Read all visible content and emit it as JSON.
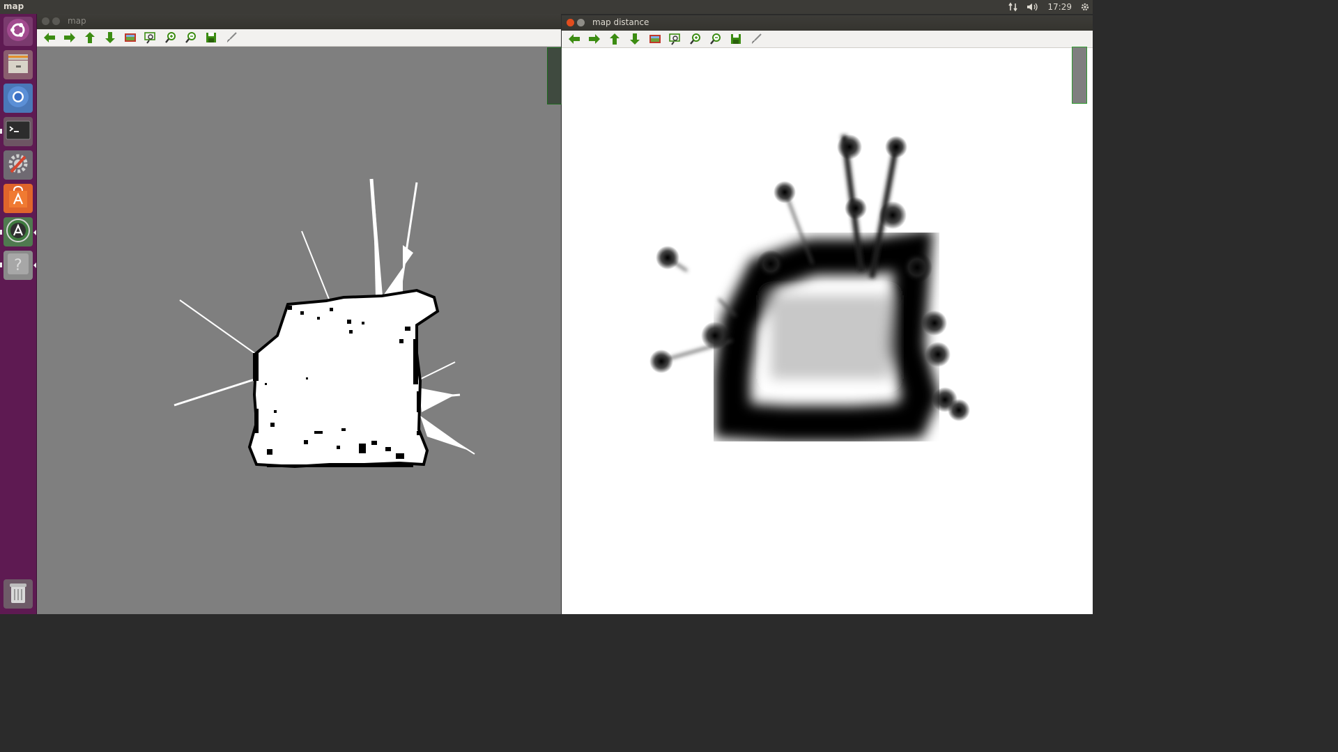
{
  "top_panel": {
    "app_title": "map",
    "clock": "17:29"
  },
  "launcher": {
    "items": [
      {
        "name": "ubuntu-logo",
        "label": "Dash"
      },
      {
        "name": "files",
        "label": "Files"
      },
      {
        "name": "chromium",
        "label": "Chromium"
      },
      {
        "name": "terminal",
        "label": "Terminal"
      },
      {
        "name": "system-settings",
        "label": "System Settings"
      },
      {
        "name": "software-center",
        "label": "Ubuntu Software"
      },
      {
        "name": "software-updater",
        "label": "Software Updater"
      },
      {
        "name": "help",
        "label": "Help"
      },
      {
        "name": "trash",
        "label": "Trash"
      }
    ]
  },
  "windows": {
    "map": {
      "title": "map",
      "canvas_bg": "#7f7f7f"
    },
    "distance": {
      "title": "map distance",
      "canvas_bg": "#ffffff"
    }
  },
  "toolbar": {
    "buttons": [
      "arrow-left-icon",
      "arrow-right-icon",
      "arrow-up-icon",
      "arrow-down-icon",
      "image-icon",
      "zoom-fit-icon",
      "zoom-in-icon",
      "zoom-out-icon",
      "save-icon",
      "brush-icon"
    ]
  },
  "colors": {
    "launcher": "#5e1a52",
    "panel": "#3c3b37",
    "toolbar_green": "#3c8c12",
    "close_red": "#e24d1e"
  }
}
